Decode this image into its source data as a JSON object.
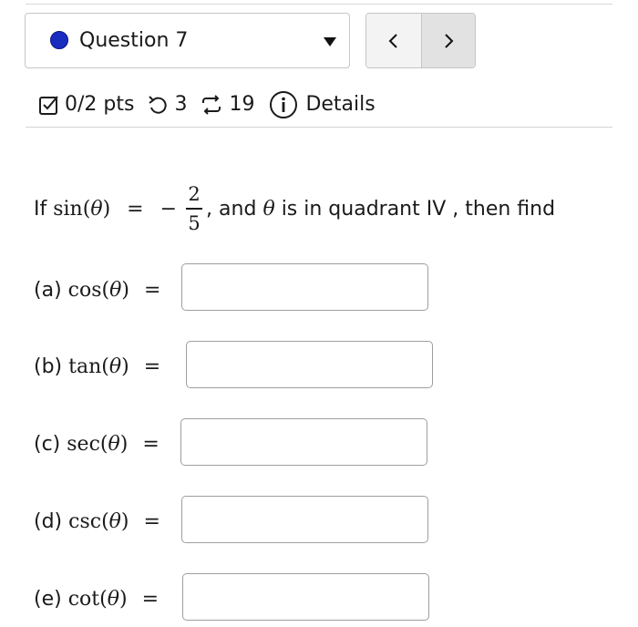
{
  "question": {
    "label": "Question 7",
    "status_color": "#1a2cbf"
  },
  "nav": {
    "prev_icon": "chevron-left",
    "next_icon": "chevron-right"
  },
  "stats": {
    "score": "0/2 pts",
    "undo_count": "3",
    "attempts": "19",
    "details_label": "Details"
  },
  "problem": {
    "prefix": "If",
    "lhs_func": "sin",
    "var": "θ",
    "equals": "=",
    "minus": "−",
    "numerator": "2",
    "denominator": "5",
    "suffix": ", and",
    "mid": "is in quadrant IV , then find"
  },
  "parts": [
    {
      "label": "(a)",
      "func": "cos",
      "value": ""
    },
    {
      "label": "(b)",
      "func": "tan",
      "value": ""
    },
    {
      "label": "(c)",
      "func": "sec",
      "value": ""
    },
    {
      "label": "(d)",
      "func": "csc",
      "value": ""
    },
    {
      "label": "(e)",
      "func": "cot",
      "value": ""
    }
  ]
}
